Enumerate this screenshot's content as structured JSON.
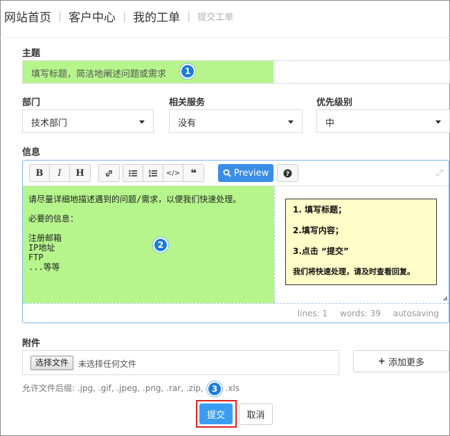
{
  "breadcrumb": {
    "items": [
      "网站首页",
      "客户中心",
      "我的工单"
    ],
    "current": "提交工单"
  },
  "subject": {
    "label": "主题",
    "placeholder": "填写标题，简洁地阐述问题或需求"
  },
  "department": {
    "label": "部门",
    "value": "技术部门"
  },
  "service": {
    "label": "相关服务",
    "value": "没有"
  },
  "priority": {
    "label": "优先级别",
    "value": "中"
  },
  "message": {
    "label": "信息",
    "toolbar": {
      "bold": "B",
      "italic": "I",
      "heading": "H",
      "link_icon": "link-icon",
      "ul_icon": "unordered-list-icon",
      "ol_icon": "ordered-list-icon",
      "code_icon": "code-icon",
      "quote_icon": "quote-icon",
      "preview_label": "Preview",
      "help_icon": "help-icon",
      "fullscreen_icon": "fullscreen-icon"
    },
    "body": "请尽量详细地描述遇到的问题/需求，以便我们快速处理。\n\n必要的信息：\n\n注册邮箱\nIP地址\nFTP\n...等等",
    "help": {
      "step1": "1. 填写标题；",
      "step2": "2.填写内容；",
      "step3": "3.点击 “提交”",
      "note": "我们将快速处理，请及时查看回复。"
    },
    "status": {
      "lines": "lines: 1",
      "words": "words: 39",
      "autosave": "autosaving"
    }
  },
  "attachment": {
    "label": "附件",
    "choose_label": "选择文件",
    "no_file": "未选择任何文件",
    "add_more": "添加更多",
    "allowed": "允许文件后缀: .jpg, .gif, .jpeg, .png, .rar, .zip, .txt, .xls"
  },
  "annotations": {
    "badge1": "1",
    "badge2": "2",
    "badge3": "3"
  },
  "actions": {
    "submit": "提交",
    "cancel": "取消"
  },
  "colors": {
    "highlight_green": "#b6f58c",
    "primary_blue": "#3a8ee6",
    "note_yellow": "#fffdc8",
    "callout_red": "#e02020"
  }
}
